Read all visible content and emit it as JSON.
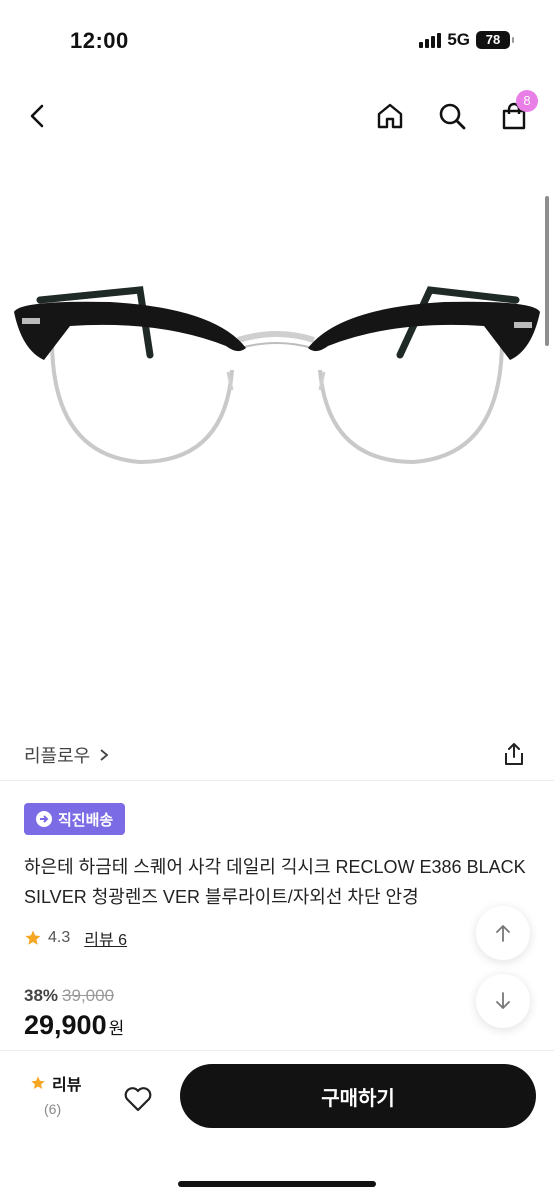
{
  "status": {
    "time": "12:00",
    "network": "5G",
    "battery": "78"
  },
  "header": {
    "cart_count": "8"
  },
  "brand": {
    "name": "리플로우"
  },
  "badge": {
    "label": "직진배송"
  },
  "product": {
    "title": "하은테 하금테 스퀘어 사각 데일리 긱시크 RECLOW E386 BLACK SILVER 청광렌즈 VER 블루라이트/자외선 차단 안경",
    "rating": "4.3",
    "review_link": "리뷰 6"
  },
  "price": {
    "discount": "38%",
    "original": "39,000",
    "final": "29,900",
    "unit": "원"
  },
  "bottom": {
    "review_label": "리뷰",
    "review_count": "(6)",
    "buy_label": "구매하기"
  },
  "colors": {
    "accent_purple": "#7b6be5",
    "badge_pink": "#e87ee6",
    "star": "#f5a623",
    "buy_button": "#121212"
  },
  "icons": [
    "back-icon",
    "home-icon",
    "search-icon",
    "bag-icon",
    "share-icon",
    "star-icon",
    "arrow-up-icon",
    "arrow-down-icon",
    "heart-icon"
  ]
}
